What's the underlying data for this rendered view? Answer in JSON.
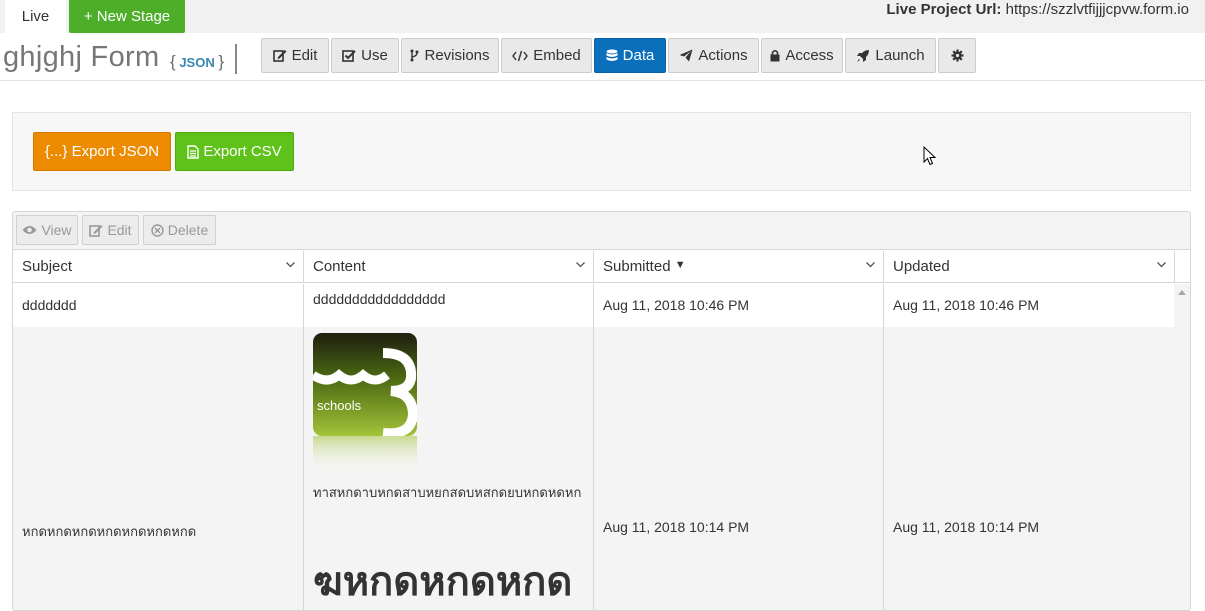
{
  "topbar": {
    "live_tab": "Live",
    "new_stage": "+ New Stage",
    "live_url_label": "Live Project Url:",
    "live_url_value": "https://szzlvtfijjjcpvw.form.io"
  },
  "header": {
    "form_title": "ghjghj Form",
    "json_badge": "JSON",
    "brace_open": "{",
    "brace_close": "}",
    "nav": [
      {
        "label": "Edit",
        "icon": "edit-icon"
      },
      {
        "label": "Use",
        "icon": "check-square-icon"
      },
      {
        "label": "Revisions",
        "icon": "branch-icon"
      },
      {
        "label": "Embed",
        "icon": "code-icon"
      },
      {
        "label": "Data",
        "icon": "database-icon",
        "active": true
      },
      {
        "label": "Actions",
        "icon": "paper-plane-icon"
      },
      {
        "label": "Access",
        "icon": "lock-icon"
      },
      {
        "label": "Launch",
        "icon": "rocket-icon"
      },
      {
        "label": "",
        "icon": "gear-icon"
      }
    ]
  },
  "export": {
    "json_label": "{...} Export JSON",
    "csv_label": "Export CSV"
  },
  "grid": {
    "toolbar": {
      "view": "View",
      "edit": "Edit",
      "delete": "Delete"
    },
    "columns": [
      "Subject",
      "Content",
      "Submitted",
      "Updated"
    ],
    "sort_indicator": "▾",
    "rows": [
      {
        "subject": "ddddddd",
        "content": "ddddddddddddddddd",
        "submitted": "Aug 11, 2018 10:46 PM",
        "updated": "Aug 11, 2018 10:46 PM"
      },
      {
        "subject": "หกดหกดหกดหกดหกดหกดหกด",
        "content_image_text": "schools",
        "content_small": "ทาสหกดาบหกดสาบหยกสดบหสกดยบหกดหดหก",
        "content_big": "ฆหกดหกดหกด",
        "submitted": "Aug 11, 2018 10:14 PM",
        "updated": "Aug 11, 2018 10:14 PM"
      }
    ]
  },
  "colors": {
    "green": "#4cae29",
    "blue_active": "#0a70bb",
    "orange": "#ed8b00",
    "csv_green": "#5fc21a"
  }
}
